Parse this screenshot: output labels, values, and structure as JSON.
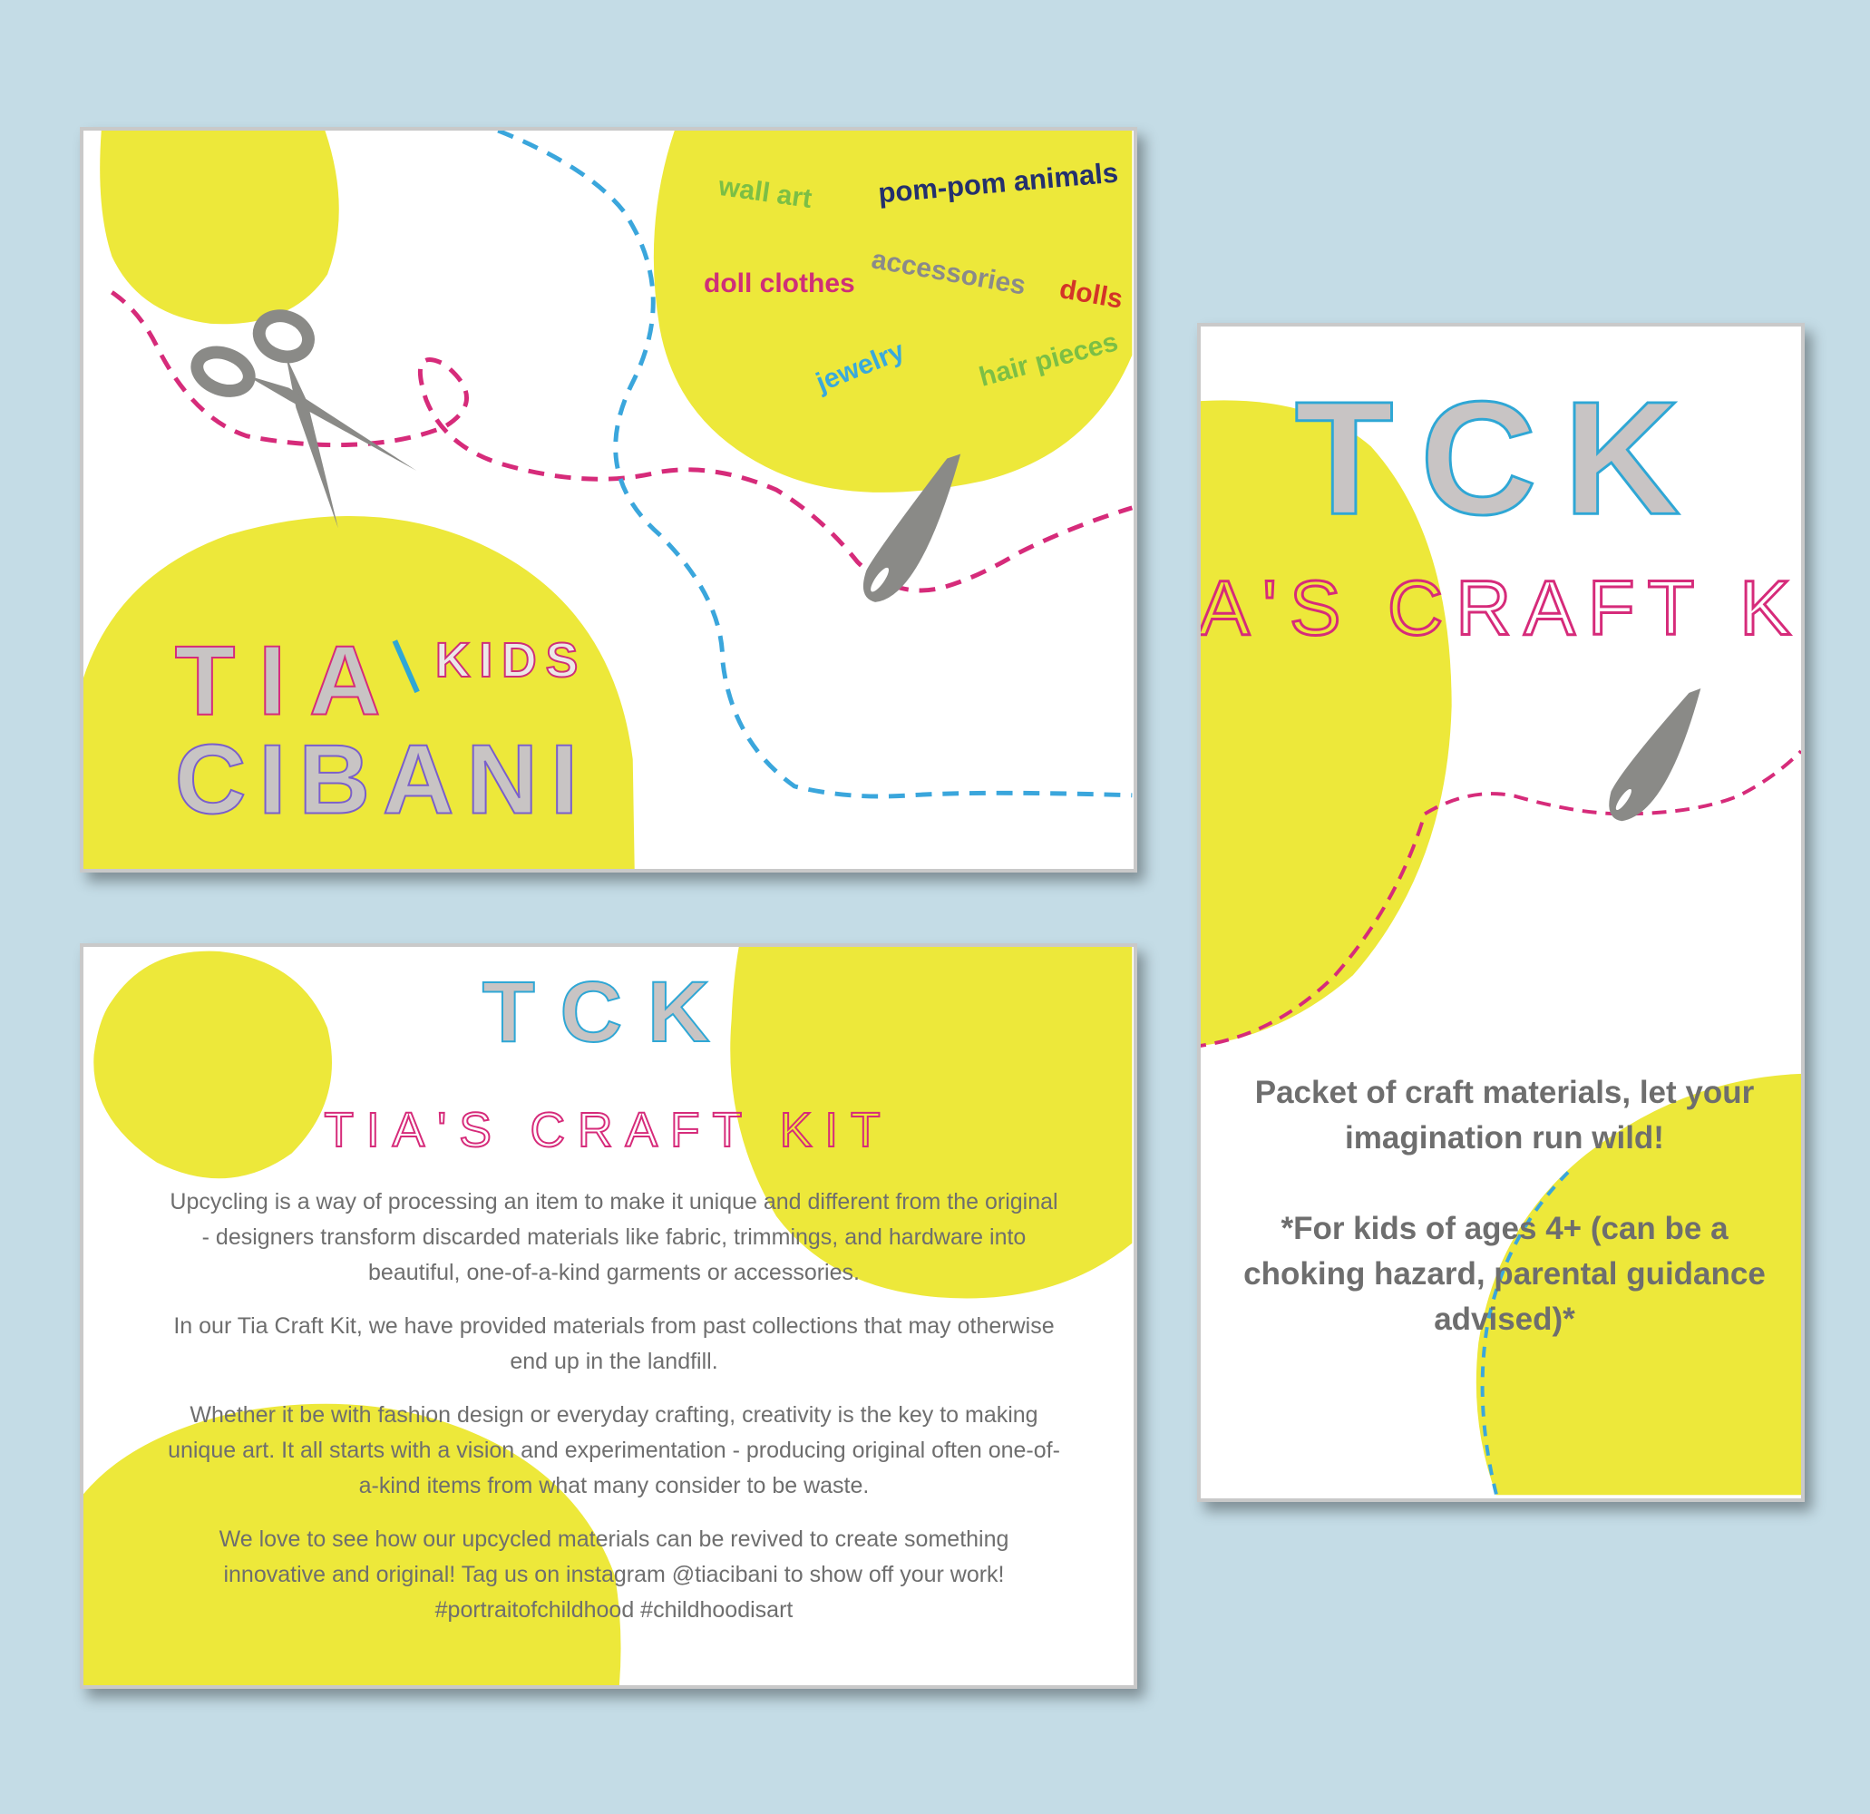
{
  "card1": {
    "brand": {
      "line1": "TIA",
      "line2": "CIBANI",
      "tag": "KIDS"
    },
    "words": {
      "wall_art": "wall art",
      "pom_pom_animals": "pom-pom animals",
      "accessories": "accessories",
      "doll_clothes": "doll clothes",
      "dolls": "dolls",
      "jewelry": "jewelry",
      "hair_pieces": "hair pieces"
    }
  },
  "card2": {
    "logo": "TCK",
    "subtitle": "TIA'S CRAFT KIT",
    "paragraphs": {
      "p1": "Upcycling is a way of processing an item to make it unique and different from the original - designers transform discarded materials like fabric, trimmings, and hardware into beautiful, one-of-a-kind garments or accessories.",
      "p2": "In our Tia Craft Kit, we have provided materials from past collections that may otherwise end up in the landfill.",
      "p3": "Whether it be with fashion design or everyday crafting, creativity is the key to making unique art. It all starts with a vision and experimentation - producing original often one-of-a-kind items from what many consider to be waste.",
      "p4": "We love to see how our upcycled materials can be revived to create something innovative and original! Tag us on instagram @tiacibani to show off your work! #portraitofchildhood #childhoodisart"
    }
  },
  "card3": {
    "logo": "TCK",
    "subtitle": "TIA'S CRAFT KIT",
    "tagline": "Packet of craft materials, let your imagination run wild!",
    "warning": "*For kids of ages 4+ (can be a choking hazard, parental guidance advised)*"
  },
  "colors": {
    "background": "#c4dce6",
    "yellow": "#ede83a",
    "pink_stitch": "#d62b7a",
    "blue_stitch": "#3aa6dc",
    "tool_gray": "#8a8a87",
    "text_gray": "#6e6e6e"
  },
  "icons": {
    "scissors": "scissors-icon",
    "needle": "needle-icon"
  }
}
